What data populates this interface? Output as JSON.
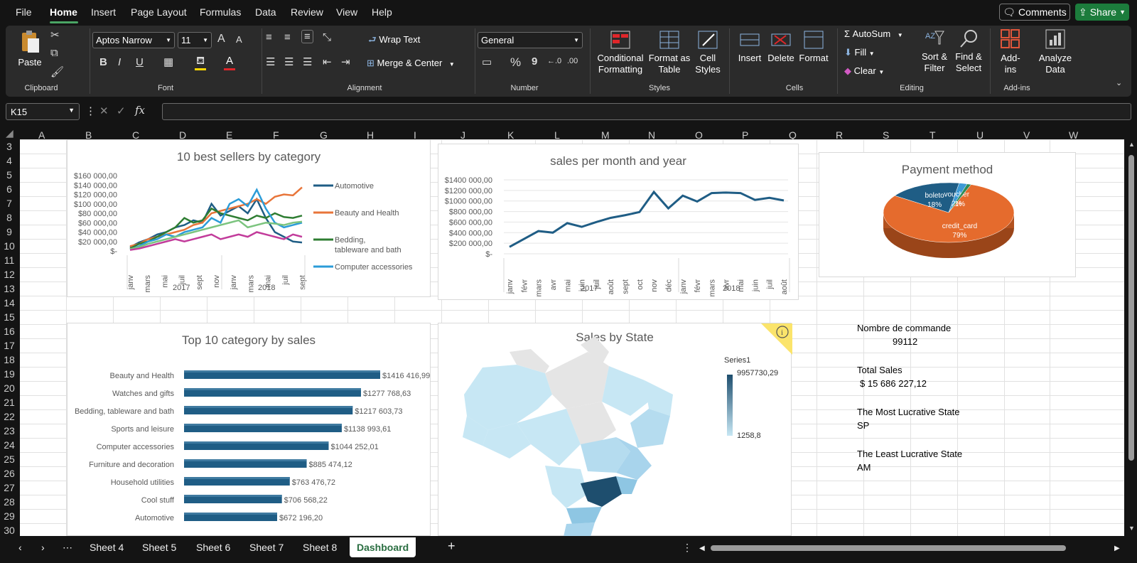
{
  "menu": {
    "items": [
      "File",
      "Home",
      "Insert",
      "Page Layout",
      "Formulas",
      "Data",
      "Review",
      "View",
      "Help"
    ],
    "active": "Home",
    "comments": "Comments",
    "share": "Share"
  },
  "ribbon": {
    "clipboard": {
      "paste": "Paste",
      "label": "Clipboard"
    },
    "font": {
      "name": "Aptos Narrow",
      "size": "11",
      "label": "Font",
      "bold": "B",
      "italic": "I",
      "underline": "U",
      "grow": "A",
      "shrink": "A",
      "fill_color": "#ffd800",
      "font_color": "#e0262a"
    },
    "alignment": {
      "wrap": "Wrap Text",
      "merge": "Merge & Center",
      "label": "Alignment"
    },
    "number": {
      "format": "General",
      "label": "Number",
      "percent": "%",
      "comma": "9"
    },
    "styles": {
      "conditional": "Conditional Formatting",
      "format_table": "Format as Table",
      "cell_styles": "Cell Styles",
      "label": "Styles"
    },
    "cells": {
      "insert": "Insert",
      "delete": "Delete",
      "format": "Format",
      "label": "Cells"
    },
    "editing": {
      "autosum": "AutoSum",
      "fill": "Fill",
      "clear": "Clear",
      "sort": "Sort & Filter",
      "find": "Find & Select",
      "label": "Editing"
    },
    "addins": {
      "addins": "Add-ins",
      "analyze": "Analyze Data",
      "label": "Add-ins"
    }
  },
  "formula_bar": {
    "name_box": "K15",
    "fx": "fx",
    "value": ""
  },
  "columns": [
    "A",
    "B",
    "C",
    "D",
    "E",
    "F",
    "G",
    "H",
    "I",
    "J",
    "K",
    "L",
    "M",
    "N",
    "O",
    "P",
    "Q",
    "R",
    "S",
    "T",
    "U",
    "V",
    "W"
  ],
  "rows": [
    "3",
    "4",
    "5",
    "6",
    "7",
    "8",
    "9",
    "10",
    "11",
    "12",
    "13",
    "14",
    "15",
    "16",
    "17",
    "18",
    "19",
    "20",
    "21",
    "22",
    "23",
    "24",
    "25",
    "26",
    "27",
    "28",
    "29",
    "30"
  ],
  "chart_data": [
    {
      "type": "line",
      "title": "10 best sellers by category",
      "y_ticks": [
        "$160 000,00",
        "$140 000,00",
        "$120 000,00",
        "$100 000,00",
        "$80 000,00",
        "$60 000,00",
        "$40 000,00",
        "$20 000,00",
        "$-"
      ],
      "x_ticks": [
        "janv",
        "mars",
        "mai",
        "juil",
        "sept",
        "nov",
        "janv",
        "mars",
        "mai",
        "juil",
        "sept"
      ],
      "x_groups": [
        "2017",
        "2018"
      ],
      "ylim": [
        0,
        160000
      ],
      "legend": [
        "Automotive",
        "Beauty and Health",
        "Bedding, tableware and bath",
        "Computer accessories"
      ],
      "series": [
        {
          "name": "Automotive",
          "color": "#1f5d85",
          "values": [
            8000,
            18000,
            25000,
            35000,
            40000,
            50000,
            55000,
            65000,
            60000,
            100000,
            75000,
            85000,
            95000,
            80000,
            110000,
            70000,
            40000,
            30000,
            20000,
            18000
          ]
        },
        {
          "name": "Beauty and Health",
          "color": "#e8753a",
          "values": [
            10000,
            15000,
            25000,
            30000,
            35000,
            40000,
            45000,
            55000,
            60000,
            80000,
            85000,
            90000,
            95000,
            100000,
            110000,
            100000,
            115000,
            120000,
            118000,
            135000
          ]
        },
        {
          "name": "Bedding, tableware and bath",
          "color": "#2e7d32",
          "values": [
            5000,
            15000,
            20000,
            30000,
            40000,
            50000,
            70000,
            60000,
            65000,
            90000,
            80000,
            75000,
            70000,
            65000,
            75000,
            70000,
            80000,
            72000,
            70000,
            75000
          ]
        },
        {
          "name": "Computer accessories",
          "color": "#2b9cd8",
          "values": [
            3000,
            10000,
            20000,
            25000,
            35000,
            30000,
            40000,
            45000,
            50000,
            70000,
            60000,
            100000,
            110000,
            95000,
            130000,
            90000,
            60000,
            50000,
            55000,
            60000
          ]
        },
        {
          "name": "",
          "color": "#7cc47f",
          "values": [
            4000,
            8000,
            15000,
            20000,
            25000,
            30000,
            35000,
            40000,
            45000,
            50000,
            55000,
            60000,
            65000,
            50000,
            55000,
            60000,
            58000,
            55000,
            60000,
            62000
          ]
        },
        {
          "name": "",
          "color": "#c23c9b",
          "values": [
            2000,
            5000,
            10000,
            15000,
            20000,
            25000,
            20000,
            25000,
            30000,
            35000,
            25000,
            30000,
            35000,
            30000,
            40000,
            35000,
            30000,
            25000,
            35000,
            30000
          ]
        }
      ]
    },
    {
      "type": "line",
      "title": "sales per month and year",
      "y_ticks": [
        "$1400 000,00",
        "$1200 000,00",
        "$1000 000,00",
        "$800 000,00",
        "$600 000,00",
        "$400 000,00",
        "$200 000,00",
        "$-"
      ],
      "ylim": [
        0,
        1400000
      ],
      "x_ticks": [
        "janv",
        "févr",
        "mars",
        "avr",
        "mai",
        "juin",
        "juil",
        "août",
        "sept",
        "oct",
        "nov",
        "déc",
        "janv",
        "févr",
        "mars",
        "avr",
        "mai",
        "juin",
        "juil",
        "août"
      ],
      "x_groups": [
        "2017",
        "2018"
      ],
      "series": [
        {
          "name": "",
          "color": "#1f5d85",
          "values": [
            130000,
            280000,
            430000,
            400000,
            580000,
            510000,
            600000,
            680000,
            730000,
            790000,
            1170000,
            860000,
            1100000,
            990000,
            1150000,
            1160000,
            1150000,
            1020000,
            1060000,
            1010000
          ]
        }
      ]
    },
    {
      "type": "pie",
      "title": "Payment method",
      "slices": [
        {
          "label": "credit_card",
          "value": 79,
          "display": "79%",
          "color": "#e56b2d"
        },
        {
          "label": "boleto",
          "value": 18,
          "display": "18%",
          "color": "#1f5d85"
        },
        {
          "label": "voucher",
          "value": 2,
          "display": "2%",
          "color": "#3c9ad6"
        },
        {
          "label": "",
          "value": 1,
          "display": "1%",
          "color": "#2e8b57"
        }
      ]
    },
    {
      "type": "bar",
      "title": "Top 10 category by sales",
      "categories": [
        "Beauty and Health",
        "Watches and gifts",
        "Bedding, tableware and bath",
        "Sports and leisure",
        "Computer accessories",
        "Furniture and decoration",
        "Household utilities",
        "Cool stuff",
        "Automotive"
      ],
      "values": [
        1416416.99,
        1277768.63,
        1217603.73,
        1138993.61,
        1044252.01,
        885474.12,
        763476.72,
        706568.22,
        672196.2
      ],
      "labels": [
        "$1416 416,99",
        "$1277 768,63",
        "$1217 603,73",
        "$1138 993,61",
        "$1044 252,01",
        "$885 474,12",
        "$763 476,72",
        "$706 568,22",
        "$672 196,20"
      ],
      "color": "#1f5d85"
    },
    {
      "type": "map",
      "title": "Sales by State",
      "legend_title": "Series1",
      "max_label": "9957730,29",
      "min_label": "1258,8"
    }
  ],
  "kpis": [
    {
      "label": "Nombre de commande",
      "value": "99112"
    },
    {
      "label": "Total Sales",
      "value": "$ 15 686 227,12"
    },
    {
      "label": "The Most Lucrative State",
      "value": "SP"
    },
    {
      "label": "The Least  Lucrative State",
      "value": "AM"
    }
  ],
  "sheets": [
    "Sheet 4",
    "Sheet 5",
    "Sheet 6",
    "Sheet 7",
    "Sheet 8",
    "Dashboard"
  ],
  "active_sheet": "Dashboard"
}
